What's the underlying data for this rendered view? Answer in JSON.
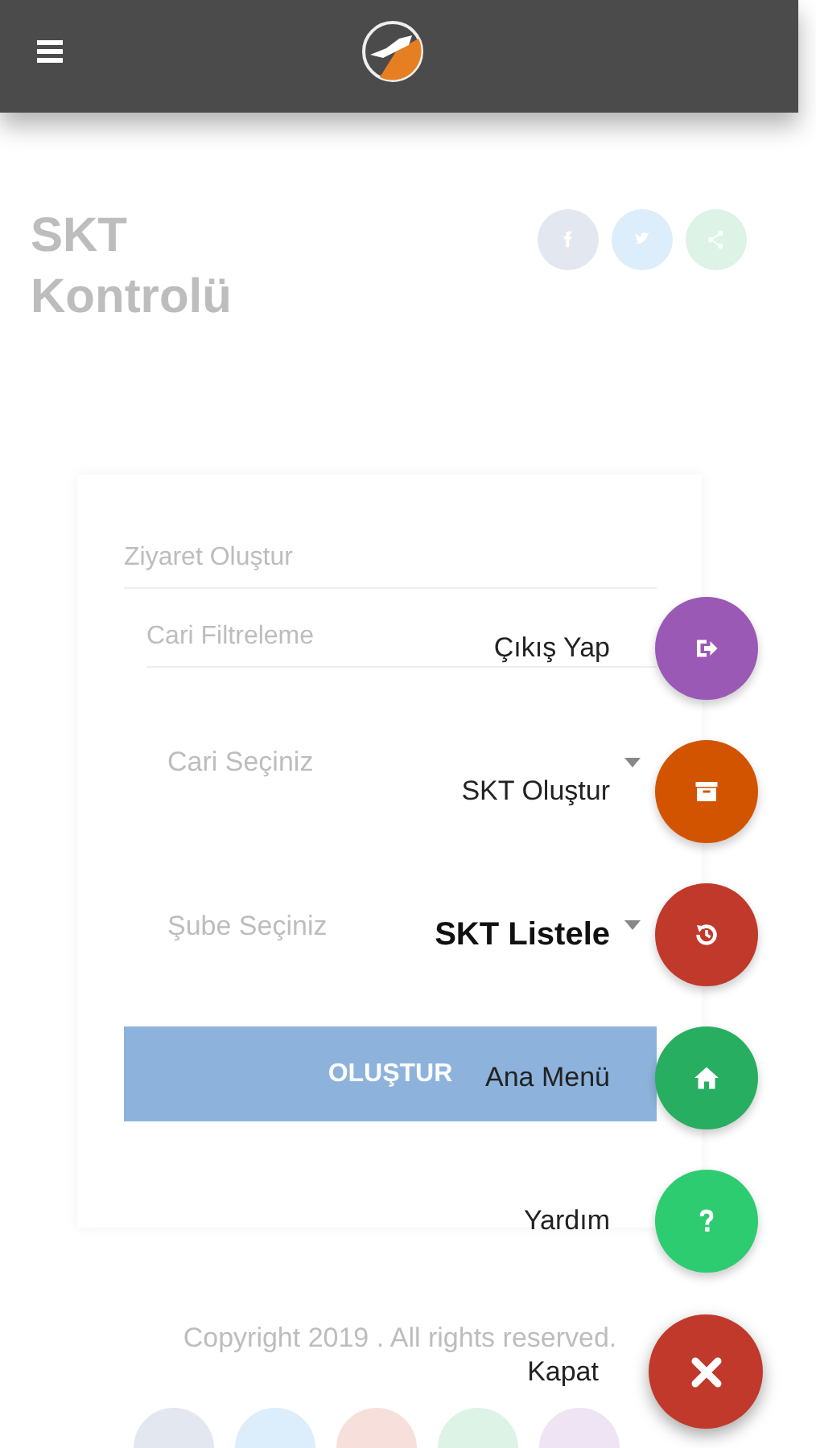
{
  "page": {
    "title": "SKT Kontrolü",
    "share_buttons": [
      {
        "kind": "facebook",
        "color": "#e3e7f0"
      },
      {
        "kind": "twitter",
        "color": "#dcedfb"
      },
      {
        "kind": "share",
        "color": "#dcf3e5"
      }
    ]
  },
  "form": {
    "fields": [
      {
        "kind": "input",
        "placeholder": "Ziyaret Oluştur"
      },
      {
        "kind": "input",
        "placeholder": "Cari Filtreleme"
      },
      {
        "kind": "select",
        "value": "Cari Seçiniz"
      },
      {
        "kind": "select",
        "value": "Şube Seçiniz"
      }
    ],
    "submit": "OLUŞTUR"
  },
  "footer": {
    "copyright": "Copyright 2019 . All rights reserved.",
    "social_buttons": [
      {
        "color": "#e3e7f0"
      },
      {
        "color": "#dcedfb"
      },
      {
        "color": "#f7e0dc"
      },
      {
        "color": "#dcf3e5"
      },
      {
        "color": "#efe4f3"
      }
    ]
  },
  "fab_menu": {
    "items": [
      {
        "label": "Çıkış Yap",
        "kind": "logout",
        "color": "#9b59b6",
        "selected": false
      },
      {
        "label": "SKT Oluştur",
        "kind": "archive",
        "color": "#d35400",
        "selected": false
      },
      {
        "label": "SKT Listele",
        "kind": "history",
        "color": "#c0392b",
        "selected": true
      },
      {
        "label": "Ana Menü",
        "kind": "home",
        "color": "#27ae60",
        "selected": false
      },
      {
        "label": "Yardım",
        "kind": "help",
        "color": "#2ecc71",
        "selected": false
      }
    ],
    "close": {
      "label": "Kapat",
      "kind": "close",
      "color": "#c0392b"
    }
  }
}
